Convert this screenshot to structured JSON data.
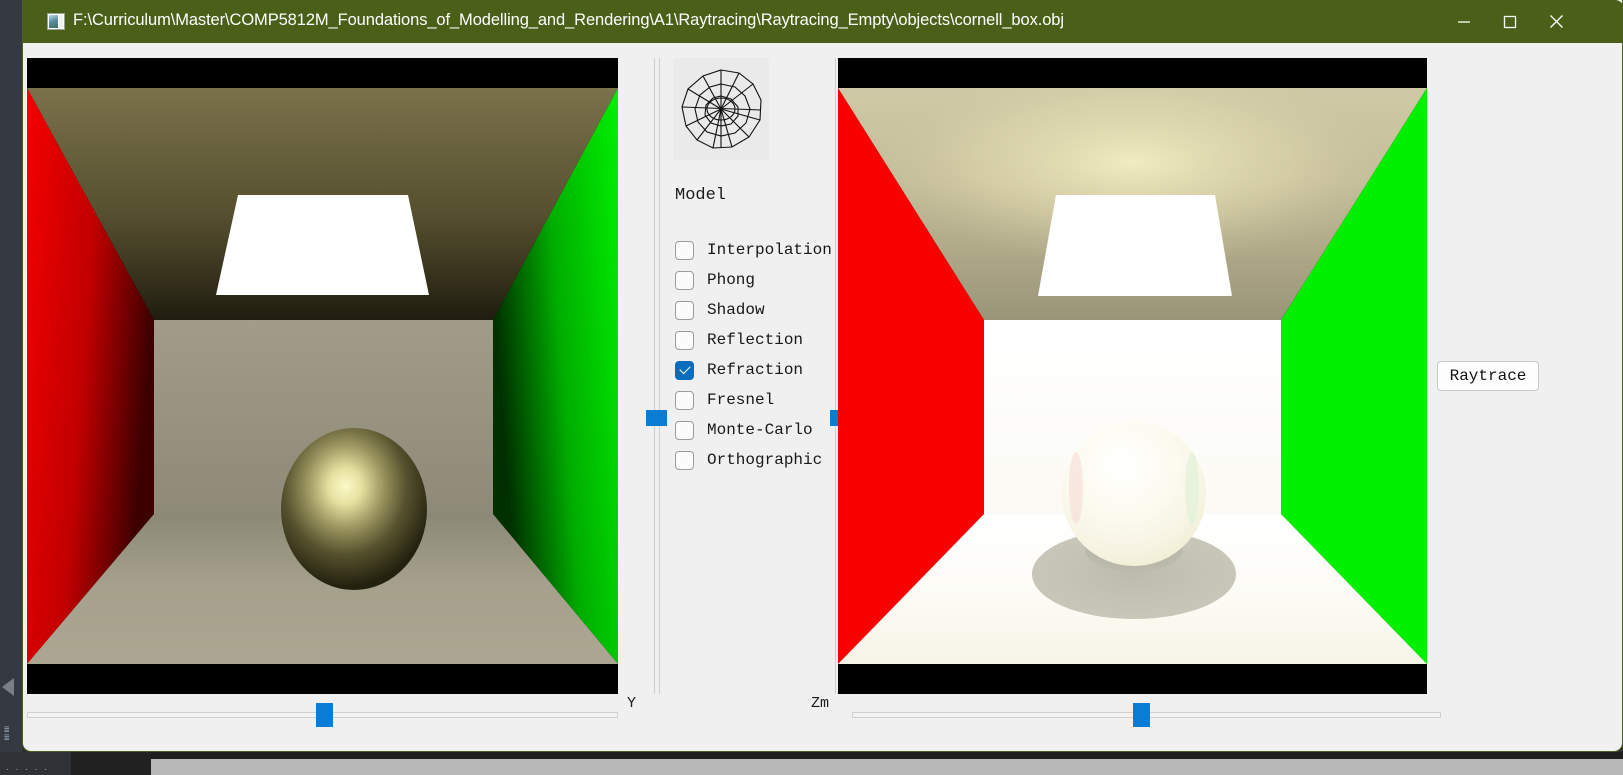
{
  "window": {
    "title": "F:\\Curriculum\\Master\\COMP5812M_Foundations_of_Modelling_and_Rendering\\A1\\Raytracing\\Raytracing_Empty\\objects\\cornell_box.obj",
    "titlebar_color": "#4a6019",
    "icon": "app-window-icon",
    "controls": {
      "minimize": "minimize-icon",
      "maximize": "maximize-icon",
      "close": "close-icon"
    }
  },
  "mid_panel": {
    "arcball": "arcball-widget",
    "group_label": "Model",
    "checkboxes": [
      {
        "label": "Interpolation",
        "checked": false
      },
      {
        "label": "Phong",
        "checked": false
      },
      {
        "label": "Shadow",
        "checked": false
      },
      {
        "label": "Reflection",
        "checked": false
      },
      {
        "label": "Refraction",
        "checked": true
      },
      {
        "label": "Fresnel",
        "checked": false
      },
      {
        "label": "Monte-Carlo",
        "checked": false
      },
      {
        "label": "Orthographic",
        "checked": false
      }
    ],
    "accent_color": "#0a7cd4"
  },
  "actions": {
    "raytrace_label": "Raytrace"
  },
  "sliders": {
    "left_horizontal": {
      "tag": "Y",
      "value_pct": 53
    },
    "right_horizontal": {
      "tag": "Zm",
      "value_pct": 51
    },
    "left_vertical": {
      "value_pct": 55
    },
    "right_vertical": {
      "value_pct": 55
    }
  },
  "views": {
    "left": {
      "name": "opengl-preview",
      "description": "Cornell box rasterized preview with dark olive ceiling, red left wall, green right wall, grey back wall and floor, white rectangular area light, dark olive shaded sphere",
      "colors": {
        "left_wall": "#e10000",
        "right_wall": "#00e000",
        "ceiling": "#6d6740",
        "back_wall": "#9a9683",
        "floor": "#a09c87",
        "light": "#ffffff",
        "sphere_highlight": "#f7f3b4",
        "sphere_base": "#3e3c22",
        "letterbox": "#000000"
      }
    },
    "right": {
      "name": "raytraced-render",
      "description": "Ray traced Cornell box with refractive glass sphere, bright white back wall and floor, flat red and green side walls, white area light, elliptical soft shadow under the sphere",
      "colors": {
        "left_wall": "#fb0000",
        "right_wall": "#00f000",
        "ceiling": "#cdc6a4",
        "back_wall": "#fefefd",
        "floor": "#fbfaf3",
        "light": "#ffffff",
        "sphere": "#fbfaee",
        "shadow": "#c2c0b2",
        "letterbox": "#000000"
      }
    }
  }
}
